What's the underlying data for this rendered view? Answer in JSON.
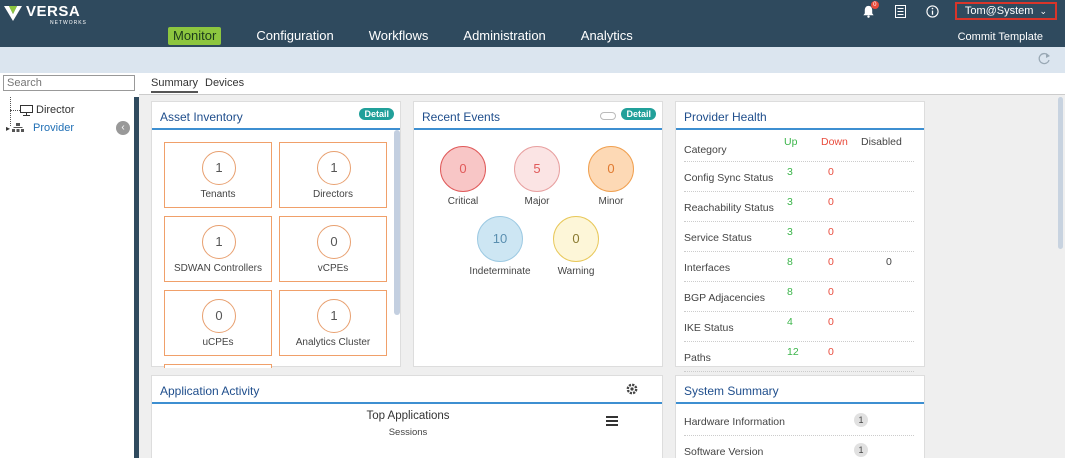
{
  "app": {
    "logo_text": "VERSA",
    "logo_subtext": "NETWORKS"
  },
  "topbar": {
    "notification_count": "0",
    "user": "Tom@System",
    "nav": [
      "Monitor",
      "Configuration",
      "Workflows",
      "Administration",
      "Analytics"
    ],
    "active_nav": "Monitor",
    "commit_template": "Commit Template"
  },
  "left_panel": {
    "search_placeholder": "Search",
    "tree": [
      {
        "label": "Director",
        "icon": "director-icon"
      },
      {
        "label": "Provider",
        "icon": "provider-icon",
        "selected": true
      }
    ]
  },
  "tabs": [
    "Summary",
    "Devices"
  ],
  "asset_inventory": {
    "title": "Asset Inventory",
    "detail": "Detail",
    "items": [
      {
        "count": "1",
        "label": "Tenants"
      },
      {
        "count": "1",
        "label": "Directors"
      },
      {
        "count": "1",
        "label": "SDWAN Controllers"
      },
      {
        "count": "0",
        "label": "vCPEs"
      },
      {
        "count": "0",
        "label": "uCPEs"
      },
      {
        "count": "1",
        "label": "Analytics Cluster"
      }
    ]
  },
  "recent_events": {
    "title": "Recent Events",
    "detail": "Detail",
    "events": [
      {
        "count": "0",
        "label": "Critical",
        "fill": "#f8c6c6",
        "stroke": "#e05a5a",
        "text": "#e05a5a"
      },
      {
        "count": "5",
        "label": "Major",
        "fill": "#fbe4e4",
        "stroke": "#e8a0a0",
        "text": "#e05a5a"
      },
      {
        "count": "0",
        "label": "Minor",
        "fill": "#fdd9b5",
        "stroke": "#f0a050",
        "text": "#e07a30"
      },
      {
        "count": "10",
        "label": "Indeterminate",
        "fill": "#cde6f3",
        "stroke": "#9cc9e2",
        "text": "#5a8fb0"
      },
      {
        "count": "0",
        "label": "Warning",
        "fill": "#fdf6d8",
        "stroke": "#e8c85a",
        "text": "#8a7a30"
      }
    ]
  },
  "provider_health": {
    "title": "Provider Health",
    "headers": {
      "category": "Category",
      "up": "Up",
      "down": "Down",
      "disabled": "Disabled"
    },
    "rows": [
      {
        "category": "Config Sync Status",
        "up": "3",
        "down": "0",
        "disabled": ""
      },
      {
        "category": "Reachability Status",
        "up": "3",
        "down": "0",
        "disabled": ""
      },
      {
        "category": "Service Status",
        "up": "3",
        "down": "0",
        "disabled": ""
      },
      {
        "category": "Interfaces",
        "up": "8",
        "down": "0",
        "disabled": "0"
      },
      {
        "category": "BGP Adjacencies",
        "up": "8",
        "down": "0",
        "disabled": ""
      },
      {
        "category": "IKE Status",
        "up": "4",
        "down": "0",
        "disabled": ""
      },
      {
        "category": "Paths",
        "up": "12",
        "down": "0",
        "disabled": ""
      }
    ]
  },
  "application_activity": {
    "title": "Application Activity",
    "chart_title": "Top Applications",
    "chart_subtitle": "Sessions"
  },
  "system_summary": {
    "title": "System Summary",
    "rows": [
      {
        "label": "Hardware Information",
        "count": "1"
      },
      {
        "label": "Software Version",
        "count": "1"
      }
    ]
  }
}
